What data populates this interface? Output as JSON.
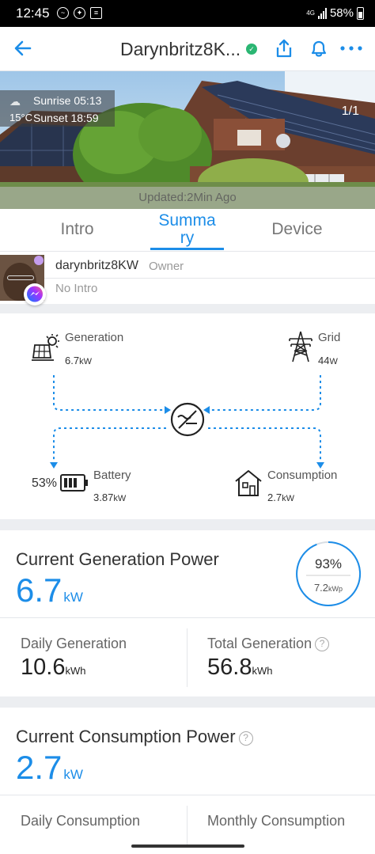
{
  "status_bar": {
    "time": "12:45",
    "network": "4G",
    "battery": "58%",
    "icons": [
      "messenger-icon",
      "accessibility-icon",
      "id-card-icon",
      "signal-icon",
      "battery-icon"
    ]
  },
  "header": {
    "title": "Darynbritz8K...",
    "icons": [
      "back-arrow-icon",
      "verified-check-icon",
      "share-icon",
      "bell-icon",
      "more-dots-icon"
    ]
  },
  "hero": {
    "sunrise": "Sunrise 05:13",
    "sunset": "Sunset 18:59",
    "temperature": "15°C",
    "updated": "Updated:2Min Ago",
    "page_indicator": "1/1"
  },
  "tabs": [
    {
      "label": "Intro",
      "active": false
    },
    {
      "label": "Summa\nry",
      "active": true
    },
    {
      "label": "Device",
      "active": false
    }
  ],
  "owner": {
    "name": "darynbritz8KW",
    "role": "Owner",
    "intro": "No Intro"
  },
  "flow": {
    "generation": {
      "label": "Generation",
      "value": "6.7",
      "unit": "kW"
    },
    "grid": {
      "label": "Grid",
      "value": "44",
      "unit": "W"
    },
    "battery": {
      "label": "Battery",
      "value": "3.87",
      "unit": "kW",
      "percent": "53%"
    },
    "consumption": {
      "label": "Consumption",
      "value": "2.7",
      "unit": "kW"
    }
  },
  "generation_card": {
    "title": "Current Generation Power",
    "value": "6.7",
    "unit": "kW",
    "ring_percent": "93%",
    "ring_capacity": "7.2",
    "ring_capacity_unit": "kWp",
    "daily_label": "Daily Generation",
    "daily_value": "10.6",
    "daily_unit": "kWh",
    "total_label": "Total Generation",
    "total_value": "56.8",
    "total_unit": "kWh"
  },
  "consumption_card": {
    "title": "Current Consumption Power",
    "value": "2.7",
    "unit": "kW",
    "daily_label": "Daily Consumption",
    "monthly_label": "Monthly Consumption"
  },
  "colors": {
    "accent": "#1c8de8",
    "verified": "#2bb673"
  }
}
